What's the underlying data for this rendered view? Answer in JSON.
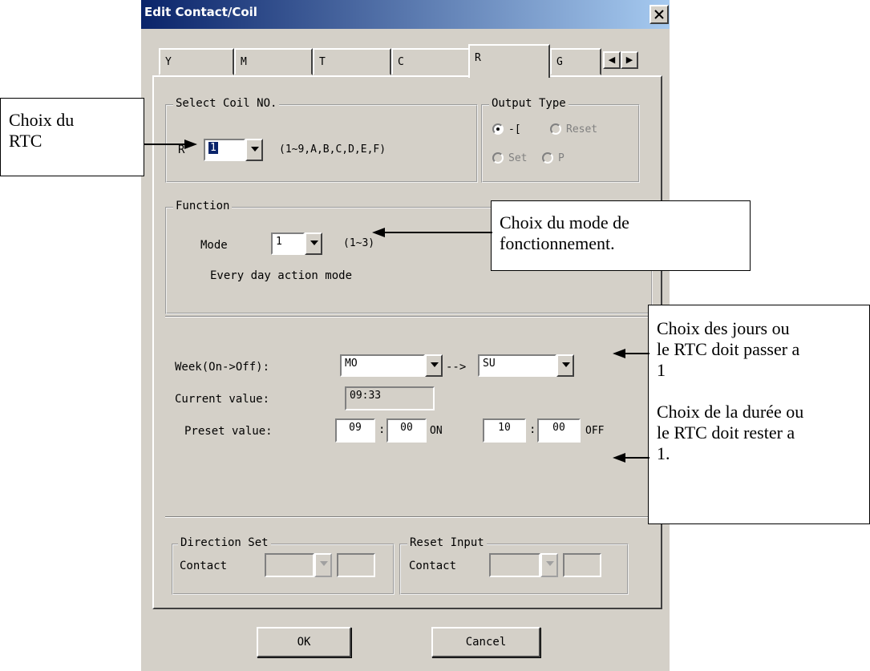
{
  "window": {
    "title": "Edit Contact/Coil",
    "close_label": "close"
  },
  "tabs": [
    {
      "label": "Y"
    },
    {
      "label": "M"
    },
    {
      "label": "T"
    },
    {
      "label": "C"
    },
    {
      "label": "R",
      "active": true
    },
    {
      "label": "G"
    }
  ],
  "select_coil": {
    "legend": "Select Coil NO.",
    "prefix": "R",
    "value": "1",
    "range_hint": "(1~9,A,B,C,D,E,F)"
  },
  "output_type": {
    "legend": "Output Type",
    "options": [
      {
        "label": "-[",
        "checked": true
      },
      {
        "label": "Reset",
        "disabled": true
      },
      {
        "label": "Set",
        "disabled": true
      },
      {
        "label": "P",
        "disabled": true
      }
    ]
  },
  "function": {
    "legend": "Function",
    "mode_label": "Mode",
    "mode_value": "1",
    "mode_range": "(1~3)",
    "description": "Every day action mode"
  },
  "week": {
    "label": "Week(On->Off):",
    "on_value": "MO",
    "arrow": "-->",
    "off_value": "SU"
  },
  "current": {
    "label": "Current value:",
    "value": "09:33"
  },
  "preset": {
    "label": "Preset value:",
    "on_hour": "09",
    "on_min": "00",
    "on_label": "ON",
    "off_hour": "10",
    "off_min": "00",
    "off_label": "OFF",
    "colon": ":"
  },
  "direction_set": {
    "legend": "Direction Set",
    "contact_label": "Contact"
  },
  "reset_input": {
    "legend": "Reset Input",
    "contact_label": "Contact"
  },
  "buttons": {
    "ok": "OK",
    "cancel": "Cancel"
  },
  "callouts": {
    "rtc": [
      "Choix du",
      "RTC"
    ],
    "mode": [
      "Choix du mode de",
      "fonctionnement."
    ],
    "days": [
      "Choix des jours ou",
      "le RTC doit passer a",
      "1"
    ],
    "duration": [
      "Choix de la durée ou",
      "le RTC doit rester a",
      "1."
    ]
  },
  "colors": {
    "titlebar_start": "#0a246a",
    "titlebar_end": "#a6caf0",
    "dialog_bg": "#d4d0c8",
    "selection": "#0a246a"
  }
}
